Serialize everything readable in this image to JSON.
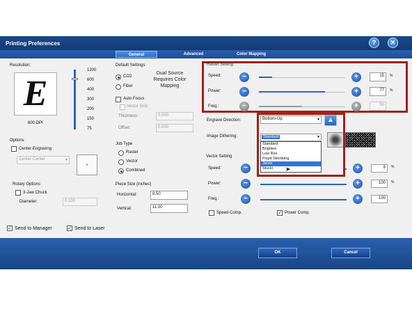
{
  "window": {
    "title": "Printing Preferences"
  },
  "title_buttons": {
    "help": "?",
    "close": "✕"
  },
  "tabs": [
    {
      "label": "General"
    },
    {
      "label": "Advanced"
    },
    {
      "label": "Color Mapping"
    }
  ],
  "resolution": {
    "title": "Resolution:",
    "logo_letter": "E",
    "value_label": "600 DPI",
    "ticks": [
      "1200",
      "600",
      "400",
      "300",
      "200",
      "150",
      "75"
    ]
  },
  "default_settings": {
    "title": "Default Settings",
    "co2": "CO2",
    "fiber": "Fiber",
    "dual_source_note": "Dual Source Requires Color Mapping",
    "auto_focus": "Auto Focus",
    "vector_grid": "Vector Grid",
    "thickness_label": "Thickness:",
    "thickness_value": "0.000",
    "offset_label": "Offset:",
    "offset_value": "0.000"
  },
  "raster": {
    "title": "Raster Setting",
    "speed_label": "Speed:",
    "speed_value": "15",
    "power_label": "Power:",
    "power_value": "77",
    "freq_label": "Freq.:",
    "freq_value": "50",
    "percent": "%",
    "speed_level": 15,
    "power_level": 77,
    "freq_level": 50
  },
  "engrave": {
    "direction_label": "Engrave Direction:",
    "direction_value": "Bottom-Up",
    "dithering_label": "Image Dithering:",
    "dithering_value": "Standard",
    "dithering_options": [
      "Standard",
      "Brighten",
      "Low Res",
      "Floyd Steinberg",
      "Jarvis",
      "Stucki"
    ],
    "highlighted_option": "Jarvis"
  },
  "options": {
    "title": "Options",
    "center_engraving": "Center-Engraving",
    "center_value": "Center-Center"
  },
  "job_type": {
    "title": "Job Type",
    "raster": "Raster",
    "vector": "Vector",
    "combined": "Combined"
  },
  "rotary": {
    "title": "Rotary Options",
    "three_jaw": "3-Jaw Chuck",
    "diameter_label": "Diameter:",
    "diameter_value": "0.100"
  },
  "piece_size": {
    "title": "Piece Size (inches)",
    "horizontal_label": "Horizontal:",
    "horizontal_value": "8.50",
    "vertical_label": "Vertical:",
    "vertical_value": "11.00"
  },
  "vector": {
    "title": "Vector Setting",
    "speed_label": "Speed:",
    "speed_value": "9",
    "power_label": "Power:",
    "power_value": "100",
    "freq_label": "Freq.:",
    "freq_value": "100",
    "percent": "%",
    "speed_comp": "Speed Comp.",
    "power_comp": "Power Comp."
  },
  "bottom": {
    "send_manager": "Send to Manager",
    "send_laser": "Send to Laser",
    "ok": "OK",
    "cancel": "Cancel"
  },
  "colors": {
    "title_bar": "#1a4a8c",
    "accent_blue": "#2b63c4",
    "highlight_red": "#a22118"
  }
}
